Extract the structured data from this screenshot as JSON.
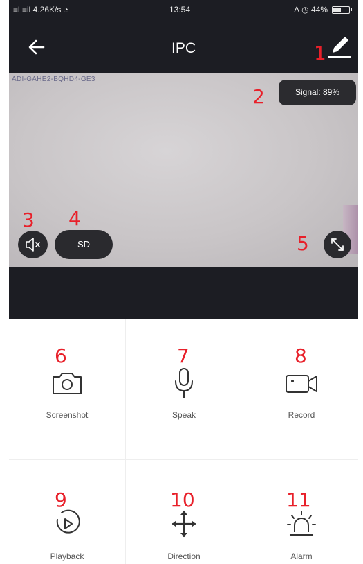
{
  "status_bar": {
    "left_text": "≡l ≡il 4.26K/s ◔",
    "time": "13:54",
    "right_text": "∆ ◷ 44%"
  },
  "header": {
    "title": "IPC",
    "back_icon": "arrow-left-icon",
    "edit_icon": "pencil-icon"
  },
  "video": {
    "timestamp": "ADI-GAHE2-BQHD4-GE3",
    "signal_label": "Signal: 89%",
    "mute_icon": "speaker-muted-icon",
    "quality_label": "SD",
    "fullscreen_icon": "fullscreen-icon"
  },
  "controls": [
    {
      "label": "Screenshot",
      "icon": "camera-icon",
      "number": "6"
    },
    {
      "label": "Speak",
      "icon": "microphone-icon",
      "number": "7"
    },
    {
      "label": "Record",
      "icon": "video-camera-icon",
      "number": "8"
    },
    {
      "label": "Playback",
      "icon": "playback-icon",
      "number": "9"
    },
    {
      "label": "Direction",
      "icon": "direction-arrows-icon",
      "number": "10"
    },
    {
      "label": "Alarm",
      "icon": "alarm-siren-icon",
      "number": "11"
    }
  ],
  "annotations": {
    "n1": "1",
    "n2": "2",
    "n3": "3",
    "n4": "4",
    "n5": "5"
  },
  "colors": {
    "dark_bar": "#1c1d23",
    "annotation_red": "#e8202a",
    "overlay_button": "#2a2a2e"
  }
}
